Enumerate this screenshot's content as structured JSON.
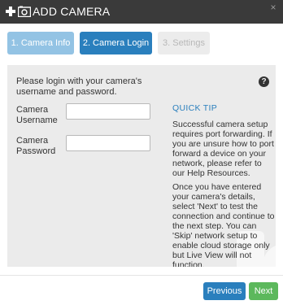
{
  "dialog": {
    "title": "ADD CAMERA",
    "close_glyph": "×"
  },
  "steps": [
    {
      "label": "1. Camera Info",
      "state": "completed"
    },
    {
      "label": "2. Camera Login",
      "state": "active"
    },
    {
      "label": "3. Settings",
      "state": "disabled"
    }
  ],
  "form": {
    "intro": "Please login with your camera's username and password.",
    "username_label": "Camera Username",
    "username_value": "",
    "password_label": "Camera Password",
    "password_value": ""
  },
  "help": {
    "glyph": "?"
  },
  "quick_tip": {
    "title": "QUICK TIP",
    "paragraph1": "Successful camera setup requires port forwarding. If you are unsure how to port forward a device on your network, please refer to our Help Resources.",
    "paragraph2": "Once you have entered your camera's details, select 'Next' to test the connection and continue to the next step. You can 'Skip' network setup to enable cloud storage only but Live View will not function."
  },
  "footer": {
    "previous_label": "Previous",
    "next_label": "Next"
  },
  "colors": {
    "titlebar": "#3a3a3a",
    "step_completed": "#93c3e4",
    "step_active": "#2a7fbd",
    "step_disabled": "#ececec",
    "panel": "#ebebeb",
    "accent": "#2a7fbd",
    "next_button": "#5cb85c"
  },
  "icons": [
    "plus-icon",
    "camera-icon",
    "close-icon",
    "help-icon"
  ]
}
